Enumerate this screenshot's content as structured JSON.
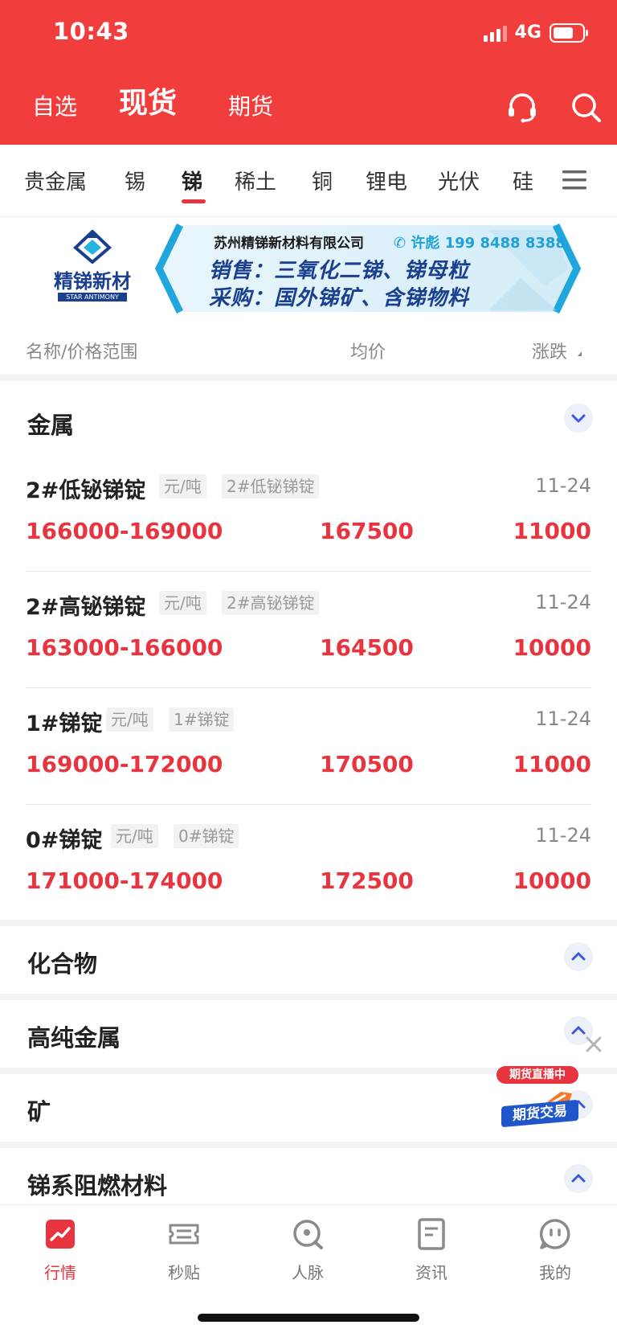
{
  "status_bar": {
    "time": "10:43",
    "network": "4G"
  },
  "top_tabs": [
    "自选",
    "现货",
    "期货"
  ],
  "active_top_tab": "现货",
  "categories": [
    "贵金属",
    "锡",
    "锑",
    "稀土",
    "铜",
    "锂电",
    "光伏",
    "硅"
  ],
  "active_category": "锑",
  "banner": {
    "logo_name": "精锑新材",
    "logo_sub": "STAR ANTIMONY",
    "company": "苏州精锑新材料有限公司",
    "phone": "许彪 199 8488 8388",
    "line1": "销售：三氧化二锑、锑母粒",
    "line2": "采购：国外锑矿、含锑物料"
  },
  "columns": {
    "name": "名称/价格范围",
    "avg": "均价",
    "change": "涨跌"
  },
  "sections": {
    "metal": {
      "title": "金属",
      "items": [
        {
          "name": "2#低铋锑锭",
          "unit": "元/吨",
          "tag": "2#低铋锑锭",
          "date": "11-24",
          "range": "166000-169000",
          "avg": "167500",
          "change": "11000"
        },
        {
          "name": "2#高铋锑锭",
          "unit": "元/吨",
          "tag": "2#高铋锑锭",
          "date": "11-24",
          "range": "163000-166000",
          "avg": "164500",
          "change": "10000"
        },
        {
          "name": "1#锑锭",
          "unit": "元/吨",
          "tag": "1#锑锭",
          "date": "11-24",
          "range": "169000-172000",
          "avg": "170500",
          "change": "11000"
        },
        {
          "name": "0#锑锭",
          "unit": "元/吨",
          "tag": "0#锑锭",
          "date": "11-24",
          "range": "171000-174000",
          "avg": "172500",
          "change": "10000"
        }
      ]
    },
    "compound": {
      "title": "化合物"
    },
    "high_purity": {
      "title": "高纯金属"
    },
    "ore": {
      "title": "矿"
    },
    "flame": {
      "title": "锑系阻燃材料"
    }
  },
  "float_ad": {
    "badge": "期货直播中",
    "text": "期货交易"
  },
  "tabbar": [
    {
      "label": "行情",
      "icon": "chart-icon"
    },
    {
      "label": "秒贴",
      "icon": "ticket-icon"
    },
    {
      "label": "人脉",
      "icon": "search-person-icon"
    },
    {
      "label": "资讯",
      "icon": "news-icon"
    },
    {
      "label": "我的",
      "icon": "profile-icon"
    }
  ],
  "colors": {
    "brand_red": "#f23d3d",
    "price_red": "#e8343f",
    "logo_blue": "#1a3f8f"
  }
}
